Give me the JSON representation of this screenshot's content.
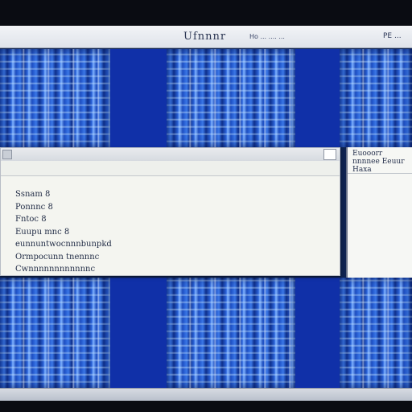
{
  "window": {
    "title": "Ufnnnr",
    "subtitle": "Ho ...   ....   ...",
    "right_label": "PE ..."
  },
  "dialog": {
    "lines": [
      "Ssnam  8",
      "Ponnnc  8",
      "Fntoc  8",
      "Euupu  mnc  8",
      "eunnuntwocnnnbunpkd",
      "Ormpocunn  tnennnc",
      "Cwnnnnnnnnnnnnc"
    ]
  },
  "sidepanel": {
    "heading": "Euooorr  nnnnee  Eeuur  Haxa"
  },
  "colors": {
    "tile_blue": "#163a9a",
    "dialog_bg": "#f4f5f0",
    "titlebar_bg": "#e9ecf0"
  }
}
